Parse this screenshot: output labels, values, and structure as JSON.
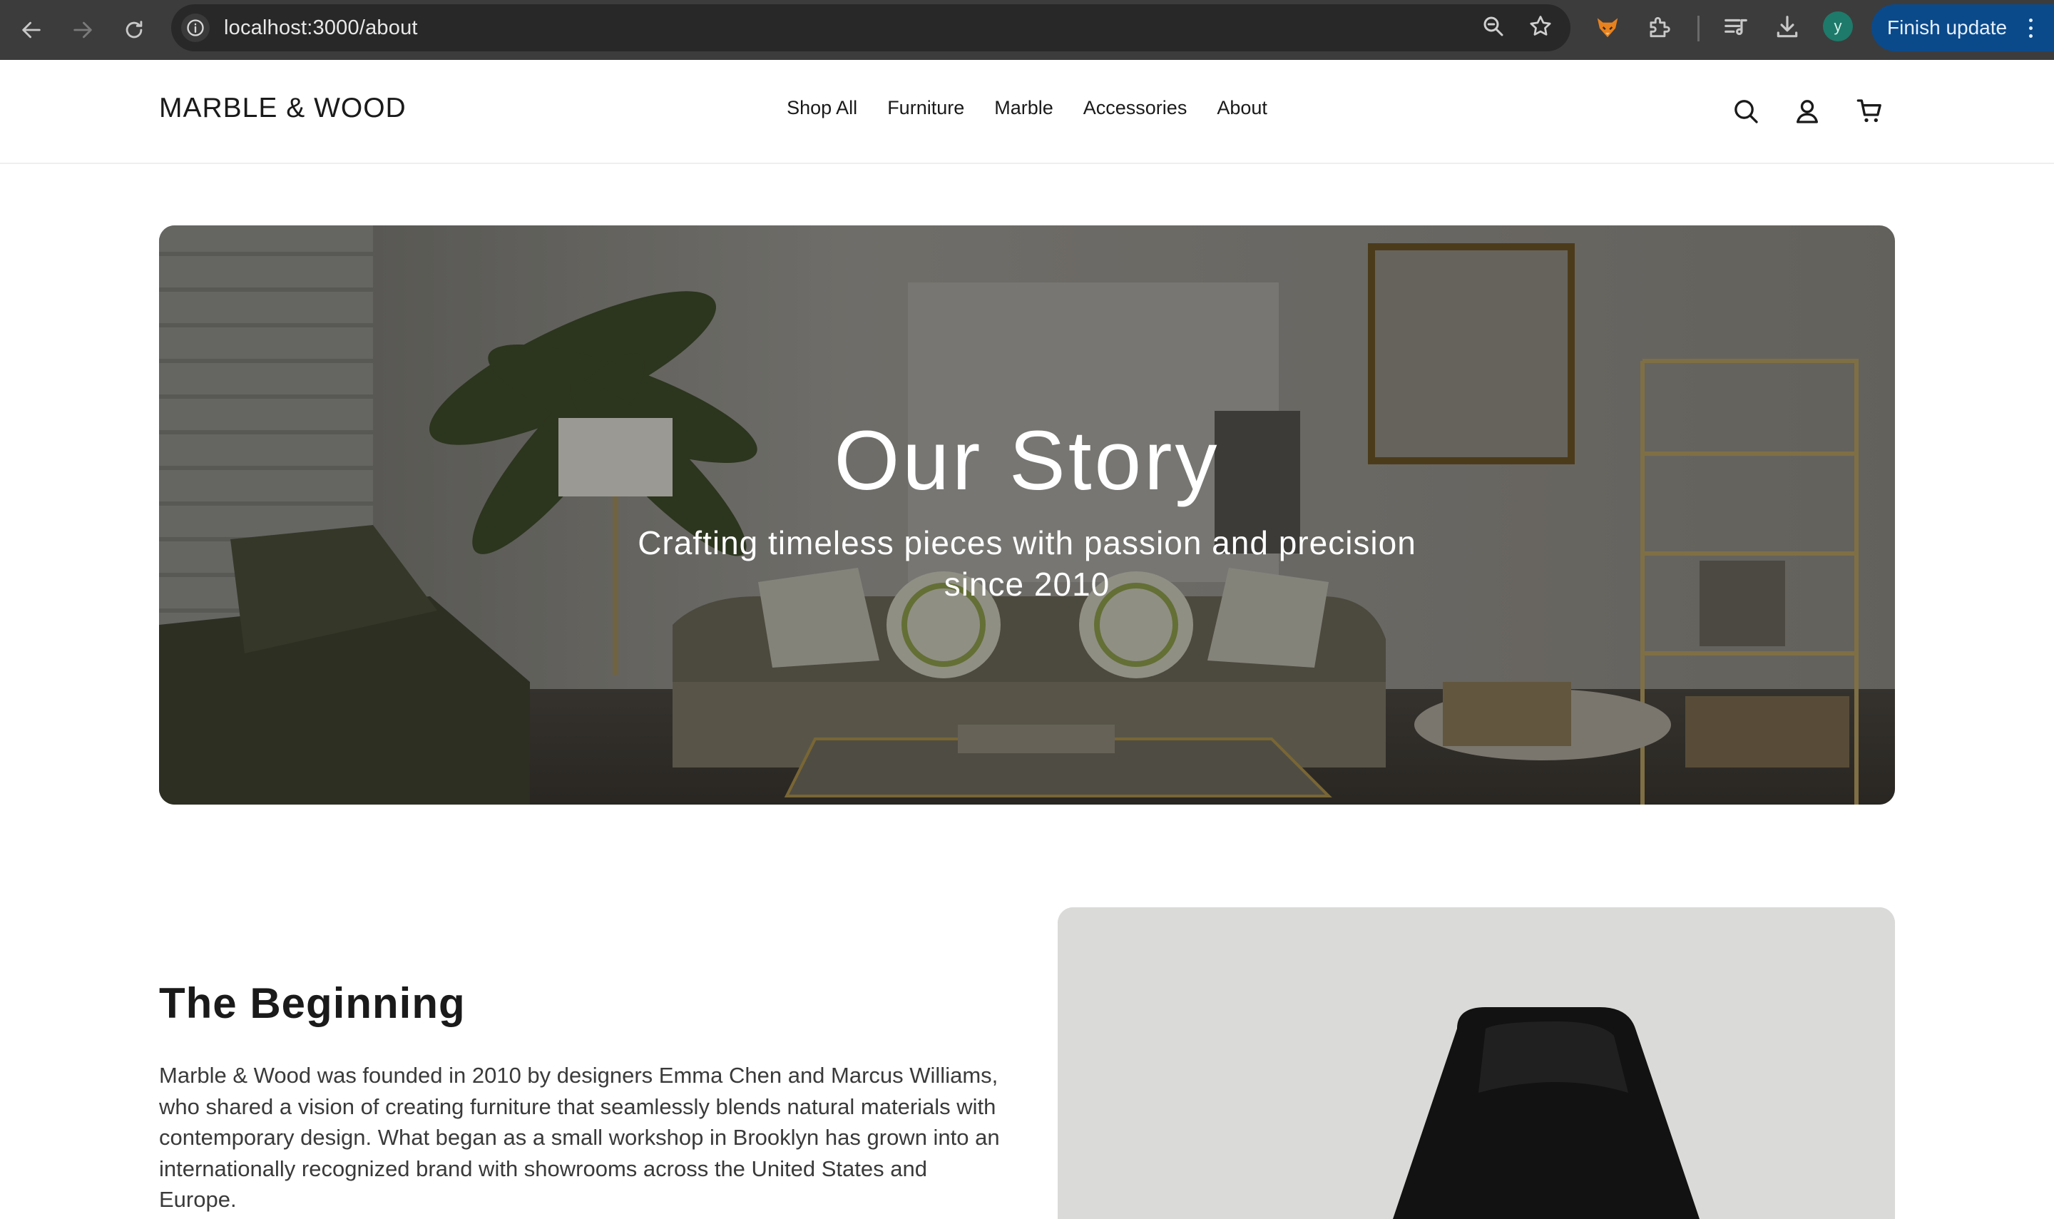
{
  "browser": {
    "url": "localhost:3000/about",
    "finish_update_label": "Finish update",
    "avatar_letter": "y"
  },
  "site": {
    "brand": "MARBLE & WOOD",
    "nav": [
      {
        "label": "Shop All"
      },
      {
        "label": "Furniture"
      },
      {
        "label": "Marble"
      },
      {
        "label": "Accessories"
      },
      {
        "label": "About"
      }
    ]
  },
  "hero": {
    "title": "Our Story",
    "subtitle": "Crafting timeless pieces with passion and precision since 2010"
  },
  "story": {
    "heading": "The Beginning",
    "paragraph": "Marble & Wood was founded in 2010 by designers Emma Chen and Marcus Williams, who shared a vision of creating furniture that seamlessly blends natural materials with contemporary design. What began as a small workshop in Brooklyn has grown into an internationally recognized brand with showrooms across the United States and Europe."
  },
  "icons": {
    "back": "arrow-left-icon",
    "forward": "arrow-right-icon",
    "reload": "reload-icon",
    "site_info": "info-icon",
    "zoom": "zoom-icon",
    "bookmark": "star-icon",
    "extension_fox": "fox-extension-icon",
    "extensions": "puzzle-icon",
    "media": "media-control-icon",
    "download": "download-icon",
    "search": "search-icon",
    "account": "user-icon",
    "cart": "cart-icon"
  }
}
